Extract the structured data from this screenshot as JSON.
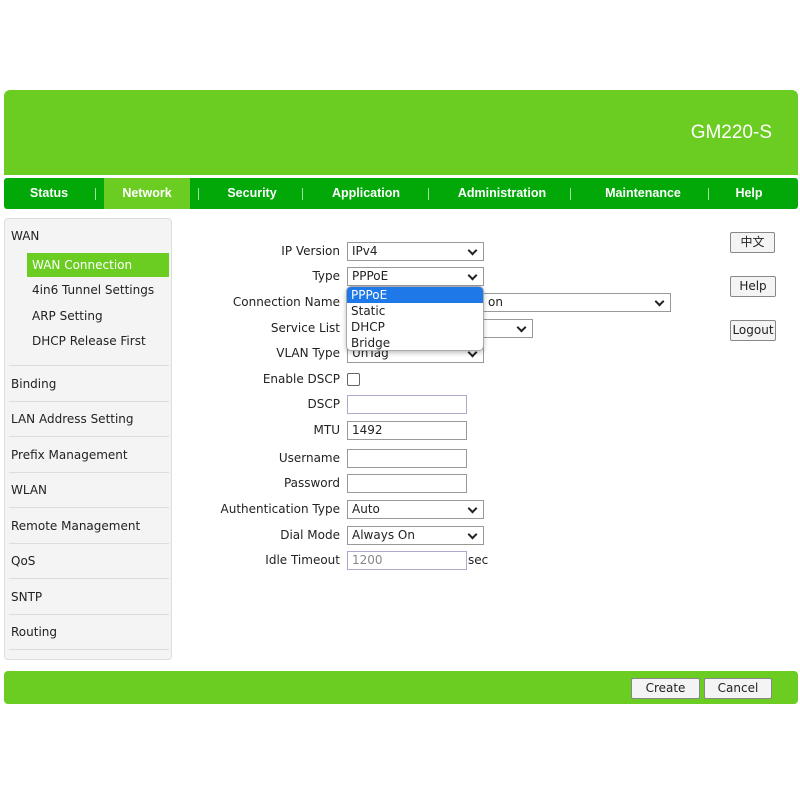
{
  "header": {
    "model": "GM220-S"
  },
  "nav": [
    {
      "label": "Status"
    },
    {
      "label": "Network",
      "active": true
    },
    {
      "label": "Security"
    },
    {
      "label": "Application"
    },
    {
      "label": "Administration"
    },
    {
      "label": "Maintenance"
    },
    {
      "label": "Help"
    }
  ],
  "sidebar": {
    "wan": "WAN",
    "sub": [
      "WAN Connection",
      "4in6 Tunnel Settings",
      "ARP Setting",
      "DHCP Release First"
    ],
    "items": [
      "Binding",
      "LAN Address Setting",
      "Prefix Management",
      "WLAN",
      "Remote Management",
      "QoS",
      "SNTP",
      "Routing"
    ]
  },
  "form": {
    "ip_version": {
      "label": "IP Version",
      "value": "IPv4"
    },
    "type": {
      "label": "Type",
      "value": "PPPoE",
      "options": [
        "PPPoE",
        "Static",
        "DHCP",
        "Bridge"
      ]
    },
    "connection_name": {
      "label": "Connection Name",
      "value": "on"
    },
    "service_list": {
      "label": "Service List",
      "value": ""
    },
    "vlan_type": {
      "label": "VLAN Type",
      "value": "UnTag"
    },
    "enable_dscp": {
      "label": "Enable DSCP",
      "checked": false
    },
    "dscp": {
      "label": "DSCP",
      "value": ""
    },
    "mtu": {
      "label": "MTU",
      "value": "1492"
    },
    "username": {
      "label": "Username",
      "value": ""
    },
    "password": {
      "label": "Password",
      "value": ""
    },
    "auth_type": {
      "label": "Authentication Type",
      "value": "Auto"
    },
    "dial_mode": {
      "label": "Dial Mode",
      "value": "Always On"
    },
    "idle_timeout": {
      "label": "Idle Timeout",
      "value": "1200",
      "unit": "sec"
    }
  },
  "side_buttons": {
    "lang": "中文",
    "help": "Help",
    "logout": "Logout"
  },
  "footer": {
    "create": "Create",
    "cancel": "Cancel"
  },
  "colors": {
    "header": "#6bcd22",
    "nav": "#02a808",
    "highlight": "#1e78e8"
  }
}
